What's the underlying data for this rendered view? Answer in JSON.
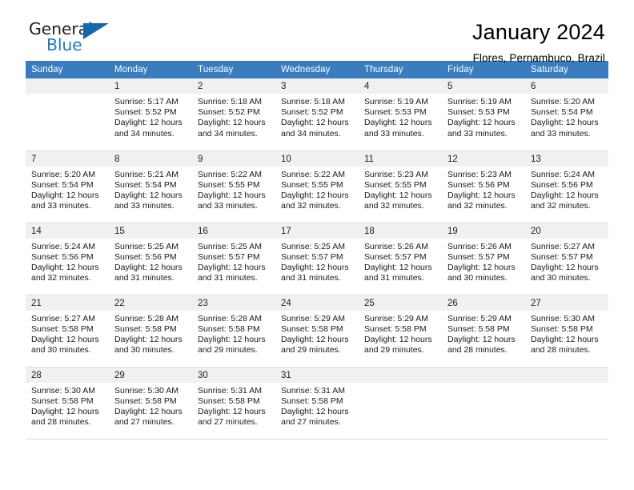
{
  "brand": {
    "name_part1": "General",
    "name_part2": "Blue",
    "accent_color": "#1567ad"
  },
  "header": {
    "title": "January 2024",
    "subtitle": "Flores, Pernambuco, Brazil"
  },
  "calendar": {
    "header_bg": "#3a7cc0",
    "weekdays": [
      "Sunday",
      "Monday",
      "Tuesday",
      "Wednesday",
      "Thursday",
      "Friday",
      "Saturday"
    ],
    "weeks": [
      [
        {
          "day": "",
          "sunrise": "",
          "sunset": "",
          "daylight1": "",
          "daylight2": ""
        },
        {
          "day": "1",
          "sunrise": "Sunrise: 5:17 AM",
          "sunset": "Sunset: 5:52 PM",
          "daylight1": "Daylight: 12 hours",
          "daylight2": "and 34 minutes."
        },
        {
          "day": "2",
          "sunrise": "Sunrise: 5:18 AM",
          "sunset": "Sunset: 5:52 PM",
          "daylight1": "Daylight: 12 hours",
          "daylight2": "and 34 minutes."
        },
        {
          "day": "3",
          "sunrise": "Sunrise: 5:18 AM",
          "sunset": "Sunset: 5:52 PM",
          "daylight1": "Daylight: 12 hours",
          "daylight2": "and 34 minutes."
        },
        {
          "day": "4",
          "sunrise": "Sunrise: 5:19 AM",
          "sunset": "Sunset: 5:53 PM",
          "daylight1": "Daylight: 12 hours",
          "daylight2": "and 33 minutes."
        },
        {
          "day": "5",
          "sunrise": "Sunrise: 5:19 AM",
          "sunset": "Sunset: 5:53 PM",
          "daylight1": "Daylight: 12 hours",
          "daylight2": "and 33 minutes."
        },
        {
          "day": "6",
          "sunrise": "Sunrise: 5:20 AM",
          "sunset": "Sunset: 5:54 PM",
          "daylight1": "Daylight: 12 hours",
          "daylight2": "and 33 minutes."
        }
      ],
      [
        {
          "day": "7",
          "sunrise": "Sunrise: 5:20 AM",
          "sunset": "Sunset: 5:54 PM",
          "daylight1": "Daylight: 12 hours",
          "daylight2": "and 33 minutes."
        },
        {
          "day": "8",
          "sunrise": "Sunrise: 5:21 AM",
          "sunset": "Sunset: 5:54 PM",
          "daylight1": "Daylight: 12 hours",
          "daylight2": "and 33 minutes."
        },
        {
          "day": "9",
          "sunrise": "Sunrise: 5:22 AM",
          "sunset": "Sunset: 5:55 PM",
          "daylight1": "Daylight: 12 hours",
          "daylight2": "and 33 minutes."
        },
        {
          "day": "10",
          "sunrise": "Sunrise: 5:22 AM",
          "sunset": "Sunset: 5:55 PM",
          "daylight1": "Daylight: 12 hours",
          "daylight2": "and 32 minutes."
        },
        {
          "day": "11",
          "sunrise": "Sunrise: 5:23 AM",
          "sunset": "Sunset: 5:55 PM",
          "daylight1": "Daylight: 12 hours",
          "daylight2": "and 32 minutes."
        },
        {
          "day": "12",
          "sunrise": "Sunrise: 5:23 AM",
          "sunset": "Sunset: 5:56 PM",
          "daylight1": "Daylight: 12 hours",
          "daylight2": "and 32 minutes."
        },
        {
          "day": "13",
          "sunrise": "Sunrise: 5:24 AM",
          "sunset": "Sunset: 5:56 PM",
          "daylight1": "Daylight: 12 hours",
          "daylight2": "and 32 minutes."
        }
      ],
      [
        {
          "day": "14",
          "sunrise": "Sunrise: 5:24 AM",
          "sunset": "Sunset: 5:56 PM",
          "daylight1": "Daylight: 12 hours",
          "daylight2": "and 32 minutes."
        },
        {
          "day": "15",
          "sunrise": "Sunrise: 5:25 AM",
          "sunset": "Sunset: 5:56 PM",
          "daylight1": "Daylight: 12 hours",
          "daylight2": "and 31 minutes."
        },
        {
          "day": "16",
          "sunrise": "Sunrise: 5:25 AM",
          "sunset": "Sunset: 5:57 PM",
          "daylight1": "Daylight: 12 hours",
          "daylight2": "and 31 minutes."
        },
        {
          "day": "17",
          "sunrise": "Sunrise: 5:25 AM",
          "sunset": "Sunset: 5:57 PM",
          "daylight1": "Daylight: 12 hours",
          "daylight2": "and 31 minutes."
        },
        {
          "day": "18",
          "sunrise": "Sunrise: 5:26 AM",
          "sunset": "Sunset: 5:57 PM",
          "daylight1": "Daylight: 12 hours",
          "daylight2": "and 31 minutes."
        },
        {
          "day": "19",
          "sunrise": "Sunrise: 5:26 AM",
          "sunset": "Sunset: 5:57 PM",
          "daylight1": "Daylight: 12 hours",
          "daylight2": "and 30 minutes."
        },
        {
          "day": "20",
          "sunrise": "Sunrise: 5:27 AM",
          "sunset": "Sunset: 5:57 PM",
          "daylight1": "Daylight: 12 hours",
          "daylight2": "and 30 minutes."
        }
      ],
      [
        {
          "day": "21",
          "sunrise": "Sunrise: 5:27 AM",
          "sunset": "Sunset: 5:58 PM",
          "daylight1": "Daylight: 12 hours",
          "daylight2": "and 30 minutes."
        },
        {
          "day": "22",
          "sunrise": "Sunrise: 5:28 AM",
          "sunset": "Sunset: 5:58 PM",
          "daylight1": "Daylight: 12 hours",
          "daylight2": "and 30 minutes."
        },
        {
          "day": "23",
          "sunrise": "Sunrise: 5:28 AM",
          "sunset": "Sunset: 5:58 PM",
          "daylight1": "Daylight: 12 hours",
          "daylight2": "and 29 minutes."
        },
        {
          "day": "24",
          "sunrise": "Sunrise: 5:29 AM",
          "sunset": "Sunset: 5:58 PM",
          "daylight1": "Daylight: 12 hours",
          "daylight2": "and 29 minutes."
        },
        {
          "day": "25",
          "sunrise": "Sunrise: 5:29 AM",
          "sunset": "Sunset: 5:58 PM",
          "daylight1": "Daylight: 12 hours",
          "daylight2": "and 29 minutes."
        },
        {
          "day": "26",
          "sunrise": "Sunrise: 5:29 AM",
          "sunset": "Sunset: 5:58 PM",
          "daylight1": "Daylight: 12 hours",
          "daylight2": "and 28 minutes."
        },
        {
          "day": "27",
          "sunrise": "Sunrise: 5:30 AM",
          "sunset": "Sunset: 5:58 PM",
          "daylight1": "Daylight: 12 hours",
          "daylight2": "and 28 minutes."
        }
      ],
      [
        {
          "day": "28",
          "sunrise": "Sunrise: 5:30 AM",
          "sunset": "Sunset: 5:58 PM",
          "daylight1": "Daylight: 12 hours",
          "daylight2": "and 28 minutes."
        },
        {
          "day": "29",
          "sunrise": "Sunrise: 5:30 AM",
          "sunset": "Sunset: 5:58 PM",
          "daylight1": "Daylight: 12 hours",
          "daylight2": "and 27 minutes."
        },
        {
          "day": "30",
          "sunrise": "Sunrise: 5:31 AM",
          "sunset": "Sunset: 5:58 PM",
          "daylight1": "Daylight: 12 hours",
          "daylight2": "and 27 minutes."
        },
        {
          "day": "31",
          "sunrise": "Sunrise: 5:31 AM",
          "sunset": "Sunset: 5:58 PM",
          "daylight1": "Daylight: 12 hours",
          "daylight2": "and 27 minutes."
        },
        {
          "day": "",
          "sunrise": "",
          "sunset": "",
          "daylight1": "",
          "daylight2": ""
        },
        {
          "day": "",
          "sunrise": "",
          "sunset": "",
          "daylight1": "",
          "daylight2": ""
        },
        {
          "day": "",
          "sunrise": "",
          "sunset": "",
          "daylight1": "",
          "daylight2": ""
        }
      ]
    ]
  }
}
